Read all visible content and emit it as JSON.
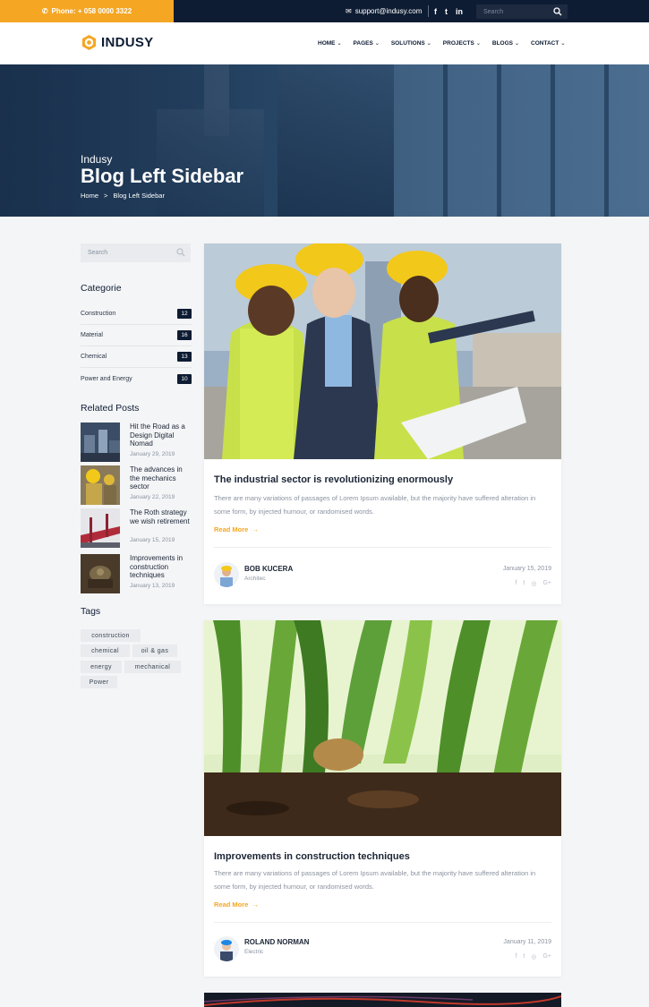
{
  "topbar": {
    "phone": "Phone: + 058 0000 3322",
    "email": "support@indusy.com",
    "social": [
      "f",
      "t",
      "in"
    ],
    "search_placeholder": "Search"
  },
  "nav": {
    "logo": "INDUSY",
    "menu": [
      {
        "label": "HOME"
      },
      {
        "label": "PAGES"
      },
      {
        "label": "SOLUTIONS"
      },
      {
        "label": "PROJECTS"
      },
      {
        "label": "BLOGS"
      },
      {
        "label": "CONTACT"
      }
    ]
  },
  "hero": {
    "subtitle": "Indusy",
    "title": "Blog Left Sidebar",
    "breadcrumb": {
      "home": "Home",
      "sep": ">",
      "current": "Blog Left Sidebar"
    }
  },
  "sidebar": {
    "search_placeholder": "Search",
    "categories_title": "Categorie",
    "categories": [
      {
        "name": "Construction",
        "count": "12"
      },
      {
        "name": "Material",
        "count": "16"
      },
      {
        "name": "Chemical",
        "count": "13"
      },
      {
        "name": "Power and Energy",
        "count": "10"
      }
    ],
    "related_title": "Related Posts",
    "related": [
      {
        "title": "Hit the Road as a Design Digital Nomad",
        "date": "January 29, 2019"
      },
      {
        "title": "The advances in the mechanics sector",
        "date": "January 22, 2019"
      },
      {
        "title": "The Roth strategy we wish retirement",
        "date": "January 15, 2019"
      },
      {
        "title": "Improvements in construction techniques",
        "date": "January 13, 2019"
      }
    ],
    "tags_title": "Tags",
    "tags": [
      "construction",
      "chemical",
      "oil & gas",
      "energy",
      "mechanical",
      "Power"
    ]
  },
  "posts": [
    {
      "title": "The industrial sector is revolutionizing enormously",
      "excerpt": "There are many variations of passages of Lorem Ipsum available, but the majority have suffered alteration in some form, by injected humour, or randomised words.",
      "read_more": "Read More",
      "author": "BOB KUCERA",
      "role": "Architec",
      "date": "January 15, 2019"
    },
    {
      "title": "Improvements in construction techniques",
      "excerpt": "There are many variations of passages of Lorem Ipsum available, but the majority have suffered alteration in some form, by injected humour, or randomised words.",
      "read_more": "Read More",
      "author": "ROLAND NORMAN",
      "role": "Electric",
      "date": "January 11, 2019"
    }
  ],
  "colors": {
    "accent": "#f5a623",
    "dark": "#0e1c33"
  }
}
